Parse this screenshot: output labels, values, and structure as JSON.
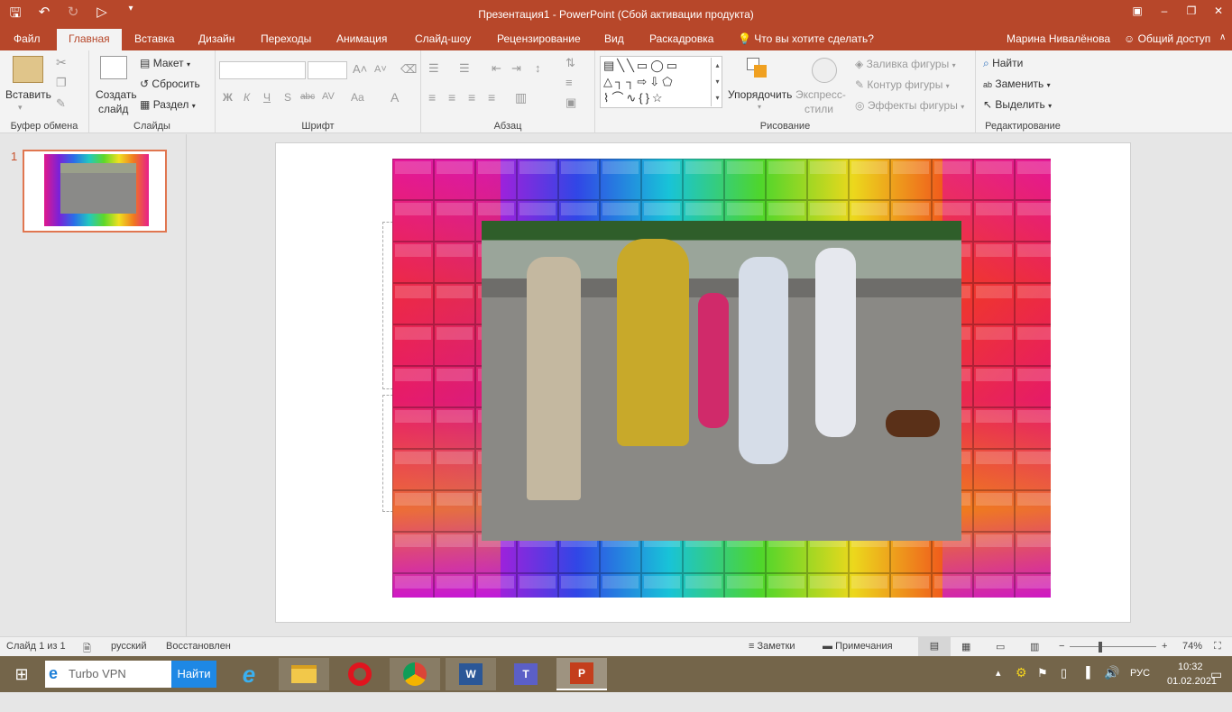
{
  "window": {
    "title": "Презентация1 - PowerPoint (Сбой активации продукта)"
  },
  "tabs": {
    "file": "Файл",
    "home": "Главная",
    "insert": "Вставка",
    "design": "Дизайн",
    "transitions": "Переходы",
    "animation": "Анимация",
    "slideshow": "Слайд-шоу",
    "review": "Рецензирование",
    "view": "Вид",
    "storyboard": "Раскадровка",
    "tellme": "Что вы хотите сделать?",
    "user": "Марина Нивалёнова",
    "share": "Общий доступ"
  },
  "ribbon": {
    "clipboard": {
      "paste": "Вставить",
      "label": "Буфер обмена"
    },
    "slides": {
      "new_slide_1": "Создать",
      "new_slide_2": "слайд",
      "layout": "Макет",
      "reset": "Сбросить",
      "section": "Раздел",
      "label": "Слайды"
    },
    "font": {
      "bold": "Ж",
      "italic": "К",
      "underline": "Ч",
      "shadow": "S",
      "strike": "abc",
      "spacing": "AV",
      "case": "Aa",
      "color": "A",
      "label": "Шрифт"
    },
    "paragraph": {
      "label": "Абзац"
    },
    "drawing": {
      "arrange": "Упорядочить",
      "styles_1": "Экспресс-",
      "styles_2": "стили",
      "fill": "Заливка фигуры",
      "outline": "Контур фигуры",
      "effects": "Эффекты фигуры",
      "label": "Рисование"
    },
    "editing": {
      "find": "Найти",
      "replace": "Заменить",
      "select": "Выделить",
      "label": "Редактирование"
    }
  },
  "slides_panel": {
    "slide_number": "1"
  },
  "status": {
    "slide": "Слайд 1 из 1",
    "language": "русский",
    "recovered": "Восстановлен",
    "notes": "Заметки",
    "comments": "Примечания",
    "zoom": "74%",
    "zoom_value": 0.74
  },
  "taskbar": {
    "search_text": "Turbo VPN",
    "search_button": "Найти",
    "lang": "РУС",
    "time": "10:32",
    "date": "01.02.2021"
  },
  "colors": {
    "accent": "#b7472a",
    "thumb_border": "#e07650"
  }
}
